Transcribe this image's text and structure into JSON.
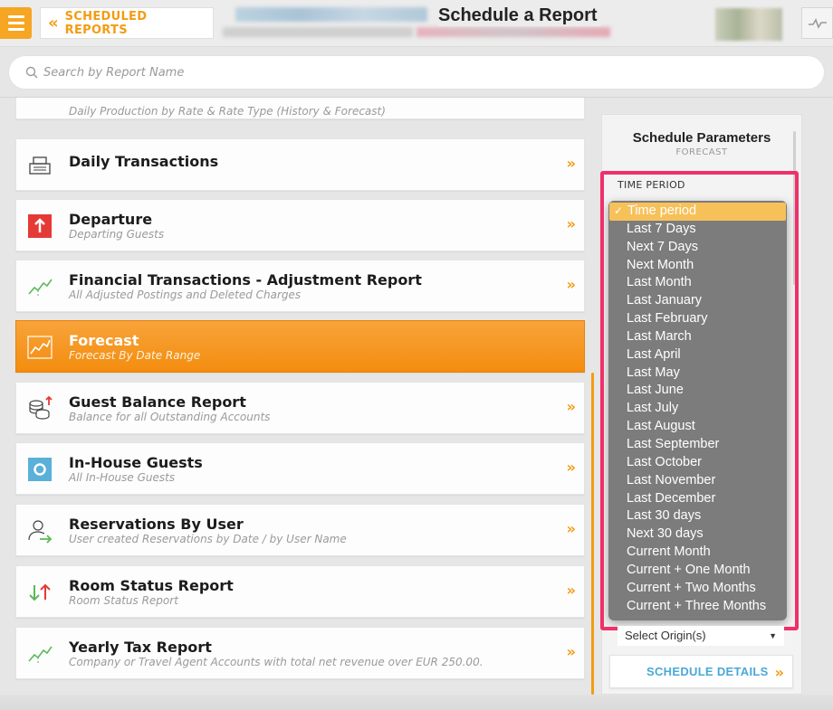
{
  "header": {
    "menu_icon": "hamburger-icon",
    "back_chevron": "«",
    "back_label": "SCHEDULED REPORTS",
    "page_title": "Schedule a Report",
    "activity_icon": "activity-icon"
  },
  "search": {
    "placeholder": "Search by Report Name",
    "value": ""
  },
  "reports": [
    {
      "title": "",
      "subtitle": "Daily Production by Rate & Rate Type (History & Forecast)",
      "icon": "chart-icon"
    },
    {
      "title": "Daily Transactions",
      "subtitle": "",
      "icon": "cash-register-icon"
    },
    {
      "title": "Departure",
      "subtitle": "Departing Guests",
      "icon": "departure-arrow-icon"
    },
    {
      "title": "Financial Transactions - Adjustment Report",
      "subtitle": "All Adjusted Postings and Deleted Charges",
      "icon": "trend-chart-icon"
    },
    {
      "title": "Forecast",
      "subtitle": "Forecast By Date Range",
      "icon": "forecast-chart-icon",
      "active": true
    },
    {
      "title": "Guest Balance Report",
      "subtitle": "Balance for all Outstanding Accounts",
      "icon": "coins-icon"
    },
    {
      "title": "In-House Guests",
      "subtitle": "All In-House Guests",
      "icon": "in-house-icon"
    },
    {
      "title": "Reservations By User",
      "subtitle": "User created Reservations by Date / by User Name",
      "icon": "user-icon"
    },
    {
      "title": "Room Status Report",
      "subtitle": "Room Status Report",
      "icon": "up-down-arrows-icon"
    },
    {
      "title": "Yearly Tax Report",
      "subtitle": "Company or Travel Agent Accounts with total net revenue over EUR 250.00.",
      "icon": "trend-chart-icon"
    }
  ],
  "go_chevron": "»",
  "panel": {
    "title": "Schedule Parameters",
    "subtitle": "FORECAST",
    "time_period_label": "TIME PERIOD",
    "time_period_options": [
      "Time period",
      "Last 7 Days",
      "Next 7 Days",
      "Next Month",
      "Last Month",
      "Last January",
      "Last February",
      "Last March",
      "Last April",
      "Last May",
      "Last June",
      "Last July",
      "Last August",
      "Last September",
      "Last October",
      "Last November",
      "Last December",
      "Last 30 days",
      "Next 30 days",
      "Current Month",
      "Current + One Month",
      "Current + Two Months",
      "Current + Three Months"
    ],
    "selected_option": "Time period",
    "check_mark": "✓",
    "origin_value": "Select Origin(s)",
    "schedule_button": "SCHEDULE DETAILS"
  },
  "colors": {
    "accent": "#f39c12",
    "highlight_box": "#f0306b",
    "link_blue": "#4aa8d8",
    "dropdown_bg": "#7c7c7c",
    "selected_option": "#f7c15a"
  }
}
